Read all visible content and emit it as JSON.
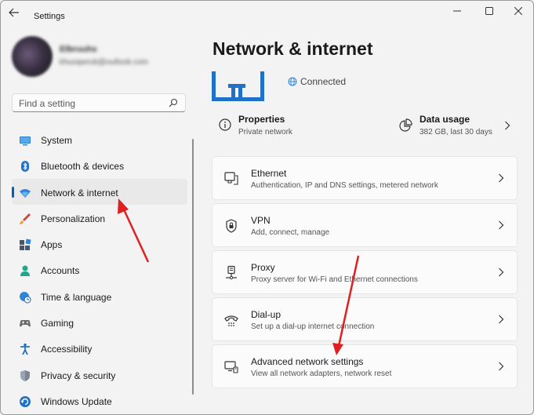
{
  "window": {
    "title": "Settings"
  },
  "user": {
    "name": "Elbruuhs",
    "email": "khuoqwrub@outlook.com"
  },
  "search": {
    "placeholder": "Find a setting"
  },
  "nav": {
    "items": [
      {
        "label": "System",
        "icon": "monitor-icon"
      },
      {
        "label": "Bluetooth & devices",
        "icon": "bluetooth-icon"
      },
      {
        "label": "Network & internet",
        "icon": "wifi-icon",
        "active": true
      },
      {
        "label": "Personalization",
        "icon": "brush-icon"
      },
      {
        "label": "Apps",
        "icon": "apps-icon"
      },
      {
        "label": "Accounts",
        "icon": "person-icon"
      },
      {
        "label": "Time & language",
        "icon": "globe-clock-icon"
      },
      {
        "label": "Gaming",
        "icon": "gamepad-icon"
      },
      {
        "label": "Accessibility",
        "icon": "accessibility-icon"
      },
      {
        "label": "Privacy & security",
        "icon": "shield-icon"
      },
      {
        "label": "Windows Update",
        "icon": "update-icon"
      }
    ]
  },
  "main": {
    "title": "Network & internet",
    "status": "Connected",
    "properties": {
      "title": "Properties",
      "subtitle": "Private network"
    },
    "data_usage": {
      "title": "Data usage",
      "subtitle": "382 GB, last 30 days"
    },
    "cards": [
      {
        "title": "Ethernet",
        "subtitle": "Authentication, IP and DNS settings, metered network",
        "icon": "ethernet-icon"
      },
      {
        "title": "VPN",
        "subtitle": "Add, connect, manage",
        "icon": "vpn-shield-icon"
      },
      {
        "title": "Proxy",
        "subtitle": "Proxy server for Wi-Fi and Ethernet connections",
        "icon": "proxy-icon"
      },
      {
        "title": "Dial-up",
        "subtitle": "Set up a dial-up internet connection",
        "icon": "dialup-icon"
      },
      {
        "title": "Advanced network settings",
        "subtitle": "View all network adapters, network reset",
        "icon": "network-pc-icon"
      }
    ]
  },
  "colors": {
    "accent": "#005fb8",
    "annotation_arrow": "#e02020"
  }
}
